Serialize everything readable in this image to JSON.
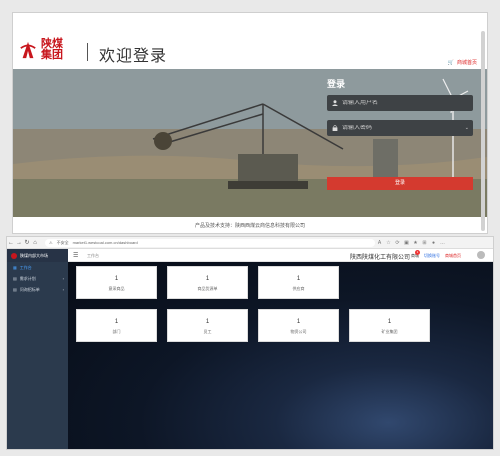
{
  "login_page": {
    "logo_text": "陕煤集团",
    "welcome": "欢迎登录",
    "mall_link": "商城首页",
    "form": {
      "title": "登录",
      "username_placeholder": "请输入用户名",
      "password_placeholder": "请输入密码",
      "submit": "登录"
    },
    "footer": "产品及技术支持：陕西西煤云商信息科技有限公司"
  },
  "browser": {
    "security_label": "不安全",
    "url": "market1.westcoal.com.cn/dashboard"
  },
  "dashboard": {
    "brand": "陕煤内部大市场",
    "menu_icon": "menu-icon",
    "breadcrumb": "工作台",
    "company": "陕西陕煤化工有限公司",
    "header_links": [
      "商城",
      "切换账号",
      "商城首页"
    ],
    "notification_count": "1",
    "sidebar": [
      {
        "label": "工作台",
        "active": true
      },
      {
        "label": "需求计划",
        "active": false
      },
      {
        "label": "问询招标单",
        "active": false
      }
    ],
    "cards": [
      {
        "value": "1",
        "label": "意采商品"
      },
      {
        "value": "1",
        "label": "商品货源单"
      },
      {
        "value": "1",
        "label": "供应商"
      },
      {
        "value": "1",
        "label": "部门"
      },
      {
        "value": "1",
        "label": "员工"
      },
      {
        "value": "1",
        "label": "物资公司"
      },
      {
        "value": "1",
        "label": "矿业集团"
      }
    ]
  },
  "colors": {
    "accent": "#c8161d",
    "login_button": "#d43a2f",
    "sidebar": "#2b3a4d",
    "link_blue": "#2d6ee0"
  }
}
